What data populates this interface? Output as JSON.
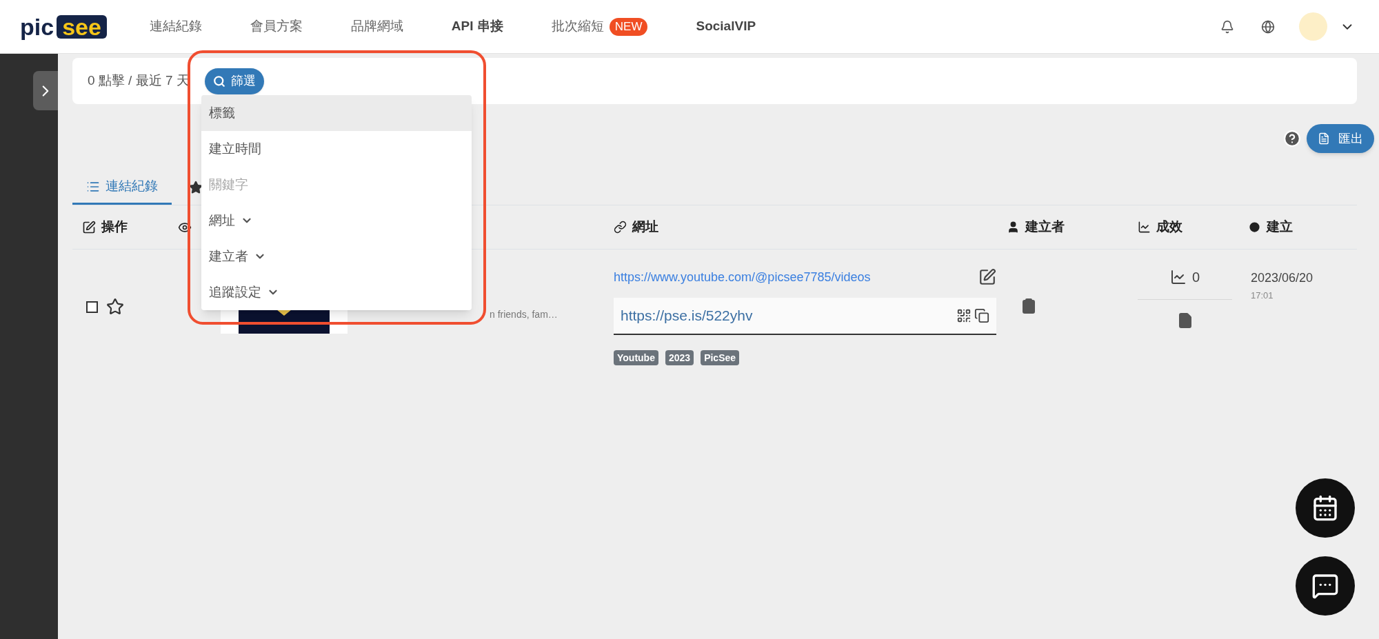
{
  "logo": {
    "part_1": "pic",
    "part_2": "see"
  },
  "nav": [
    {
      "label": "連結紀錄",
      "bold": false
    },
    {
      "label": "會員方案",
      "bold": false
    },
    {
      "label": "品牌網域",
      "bold": false
    },
    {
      "label": "API 串接",
      "bold": true
    },
    {
      "label": "批次縮短",
      "bold": false,
      "badge": "NEW"
    },
    {
      "label": "SocialVIP",
      "bold": true
    }
  ],
  "summary": "0 點擊 / 最近 7 天",
  "filter_button": "篩選",
  "filter_menu": [
    {
      "label": "標籤",
      "selected": true,
      "disabled": false,
      "expandable": false
    },
    {
      "label": "建立時間",
      "selected": false,
      "disabled": false,
      "expandable": false
    },
    {
      "label": "關鍵字",
      "selected": false,
      "disabled": true,
      "expandable": false
    },
    {
      "label": "網址",
      "selected": false,
      "disabled": false,
      "expandable": true
    },
    {
      "label": "建立者",
      "selected": false,
      "disabled": false,
      "expandable": true
    },
    {
      "label": "追蹤設定",
      "selected": false,
      "disabled": false,
      "expandable": true
    }
  ],
  "export_button": "匯出",
  "tabs": [
    {
      "label": "連結紀錄",
      "selected": true
    }
  ],
  "table": {
    "columns": [
      "操作",
      "網址",
      "建立者",
      "成效",
      "建立"
    ],
    "rows": [
      {
        "checked": false,
        "starred": false,
        "description": "n friends, fam…",
        "long_url": "https://www.youtube.com/@picsee7785/videos",
        "short_url": "https://pse.is/522yhv",
        "tags": [
          "Youtube",
          "2023",
          "PicSee"
        ],
        "clicks": "0",
        "date": "2023/06/20",
        "time": "17:01"
      }
    ]
  }
}
